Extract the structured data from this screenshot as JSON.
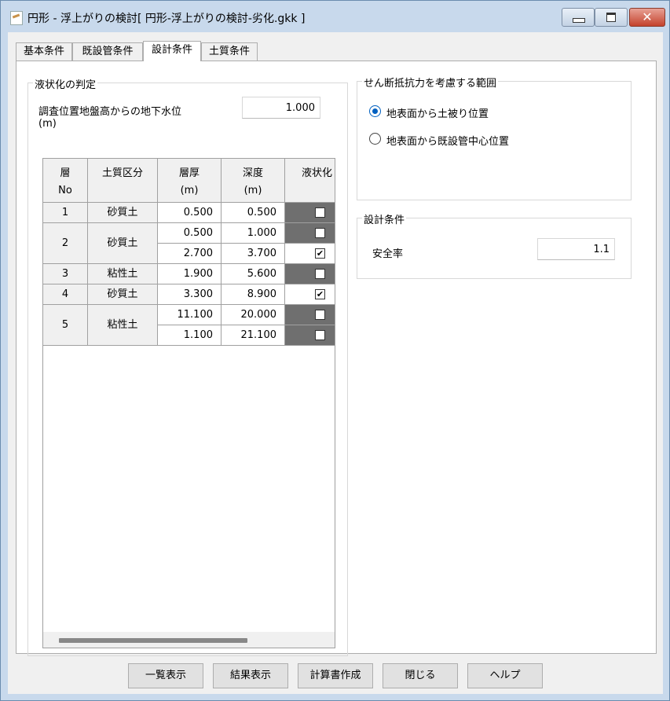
{
  "window": {
    "title": "円形 - 浮上がりの検討[ 円形-浮上がりの検討-劣化.gkk ]",
    "minimize_label": "",
    "maximize_label": "",
    "close_label": "✕"
  },
  "tabs": [
    {
      "label": "基本条件",
      "active": false
    },
    {
      "label": "既設管条件",
      "active": false
    },
    {
      "label": "設計条件",
      "active": true
    },
    {
      "label": "土質条件",
      "active": false
    }
  ],
  "liquefaction": {
    "group_title": "液状化の判定",
    "water_level_label_line1": "調査位置地盤高からの地下水位",
    "water_level_label_line2": "(m)",
    "water_level_value": "1.000",
    "table": {
      "headers": {
        "layer_no": [
          "層",
          "No"
        ],
        "soil_type": "土質区分",
        "thickness": [
          "層厚",
          "(m)"
        ],
        "depth": [
          "深度",
          "(m)"
        ],
        "liquefaction": "液状化"
      },
      "layers": [
        {
          "no": "1",
          "soil": "砂質土",
          "rows": [
            {
              "thickness": "0.500",
              "depth": "0.500",
              "checked": false
            }
          ]
        },
        {
          "no": "2",
          "soil": "砂質土",
          "rows": [
            {
              "thickness": "0.500",
              "depth": "1.000",
              "checked": false
            },
            {
              "thickness": "2.700",
              "depth": "3.700",
              "checked": true
            }
          ]
        },
        {
          "no": "3",
          "soil": "粘性土",
          "rows": [
            {
              "thickness": "1.900",
              "depth": "5.600",
              "checked": false
            }
          ]
        },
        {
          "no": "4",
          "soil": "砂質土",
          "rows": [
            {
              "thickness": "3.300",
              "depth": "8.900",
              "checked": true
            }
          ]
        },
        {
          "no": "5",
          "soil": "粘性土",
          "rows": [
            {
              "thickness": "11.100",
              "depth": "20.000",
              "checked": false
            },
            {
              "thickness": "1.100",
              "depth": "21.100",
              "checked": false
            }
          ]
        }
      ]
    }
  },
  "shear_range": {
    "group_title": "せん断抵抗力を考慮する範囲",
    "options": [
      {
        "label": "地表面から土被り位置",
        "selected": true
      },
      {
        "label": "地表面から既設管中心位置",
        "selected": false
      }
    ]
  },
  "design": {
    "group_title": "設計条件",
    "safety_factor_label": "安全率",
    "safety_factor_value": "1.1"
  },
  "buttons": {
    "list": "一覧表示",
    "results": "結果表示",
    "report": "計算書作成",
    "close": "閉じる",
    "help": "ヘルプ"
  },
  "colors": {
    "title_bar": "#c8d9ec",
    "close_button": "#c4422c",
    "dark_cell": "#6f6f6f",
    "radio_accent": "#0060c0"
  }
}
